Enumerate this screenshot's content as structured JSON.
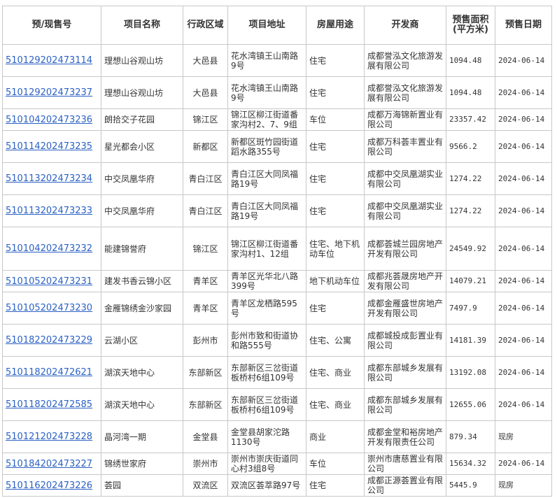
{
  "columns": [
    "预/现售号",
    "项目名称",
    "行政区域",
    "项目地址",
    "房屋用途",
    "开发商",
    "预售面积(平方米)",
    "预售日期"
  ],
  "rows": [
    {
      "num": "510129202473114",
      "name": "理想山谷观山坊",
      "district": "大邑县",
      "address": "花水湾镇王山南路9号",
      "usage": "住宅",
      "developer": "成都誉泓文化旅游发展有限公司",
      "area": "1094.48",
      "date": "2024-06-14"
    },
    {
      "num": "510129202473237",
      "name": "理想山谷观山坊",
      "district": "大邑县",
      "address": "花水湾镇王山南路9号",
      "usage": "住宅",
      "developer": "成都誉泓文化旅游发展有限公司",
      "area": "1094.48",
      "date": "2024-06-14"
    },
    {
      "num": "510104202473236",
      "name": "朗拾交子花园",
      "district": "锦江区",
      "address": "锦江区柳江街道番家沟村2、7、9组",
      "usage": "车位",
      "developer": "成都万海锦新置业有限公司",
      "area": "23357.42",
      "date": "2024-06-14"
    },
    {
      "num": "510114202473235",
      "name": "星光都会小区",
      "district": "新都区",
      "address": "新都区斑竹园街道蹈水路355号",
      "usage": "住宅",
      "developer": "成都万科荟丰置业有限公司",
      "area": "9566.2",
      "date": "2024-06-14"
    },
    {
      "num": "510113202473234",
      "name": "中交凤凰华府",
      "district": "青白江区",
      "address": "青白江区大同凤福路19号",
      "usage": "住宅",
      "developer": "成都中交凤凰湖实业有限公司",
      "area": "1274.22",
      "date": "2024-06-14"
    },
    {
      "num": "510113202473233",
      "name": "中交凤凰华府",
      "district": "青白江区",
      "address": "青白江区大同凤福路19号",
      "usage": "住宅",
      "developer": "成都中交凤凰湖实业有限公司",
      "area": "1274.22",
      "date": "2024-06-14"
    },
    {
      "num": "510104202473232",
      "name": "能建锦誉府",
      "district": "锦江区",
      "address": "锦江区柳江街道番家沟村1、12组",
      "usage": "住宅、地下机动车位",
      "developer": "成都荟城兰园房地产开发有限公司",
      "area": "24549.92",
      "date": "2024-06-14"
    },
    {
      "num": "510105202473231",
      "name": "建发书香云锦小区",
      "district": "青羊区",
      "address": "青羊区光华北八路399号",
      "usage": "地下机动车位",
      "developer": "成都兆荟晟房地产开发有限公司",
      "area": "14079.21",
      "date": "2024-06-14"
    },
    {
      "num": "510105202473230",
      "name": "金雁锦绣金沙家园",
      "district": "青羊区",
      "address": "青羊区龙栖路595号",
      "usage": "住宅",
      "developer": "成都金雁盛世房地产开发有限公司",
      "area": "7497.9",
      "date": "2024-06-14"
    },
    {
      "num": "510182202473229",
      "name": "云湖小区",
      "district": "彭州市",
      "address": "彭州市致和街道协和路555号",
      "usage": "住宅、公寓",
      "developer": "成都城投成彭置业有限公司",
      "area": "14181.39",
      "date": "2024-06-14"
    },
    {
      "num": "510118202472621",
      "name": "湖滨天地中心",
      "district": "东部新区",
      "address": "东部新区三岔街道板桥村6组109号",
      "usage": "住宅、商业",
      "developer": "成都东部城乡发展有限公司",
      "area": "13192.08",
      "date": "2024-06-14"
    },
    {
      "num": "510118202472585",
      "name": "湖滨天地中心",
      "district": "东部新区",
      "address": "东部新区三岔街道板桥村6组109号",
      "usage": "住宅、商业",
      "developer": "成都东部城乡发展有限公司",
      "area": "12655.06",
      "date": "2024-06-14"
    },
    {
      "num": "510121202473228",
      "name": "晶河湾一期",
      "district": "金堂县",
      "address": "金堂县胡家沱路1130号",
      "usage": "商业",
      "developer": "成都金堂和裕房地产开发有限责任公司",
      "area": "879.34",
      "date": "现房"
    },
    {
      "num": "510184202473227",
      "name": "锦绣世家府",
      "district": "崇州市",
      "address": "崇州市崇庆街道同心村3组8号",
      "usage": "车位",
      "developer": "崇州市唐慈置业有限公司",
      "area": "15634.32",
      "date": "2024-06-14"
    },
    {
      "num": "510116202473226",
      "name": "荟园",
      "district": "双流区",
      "address": "双流区荟萃路97号",
      "usage": "住宅",
      "developer": "成都正源荟置业有限公司",
      "area": "5445.9",
      "date": "现房"
    }
  ]
}
